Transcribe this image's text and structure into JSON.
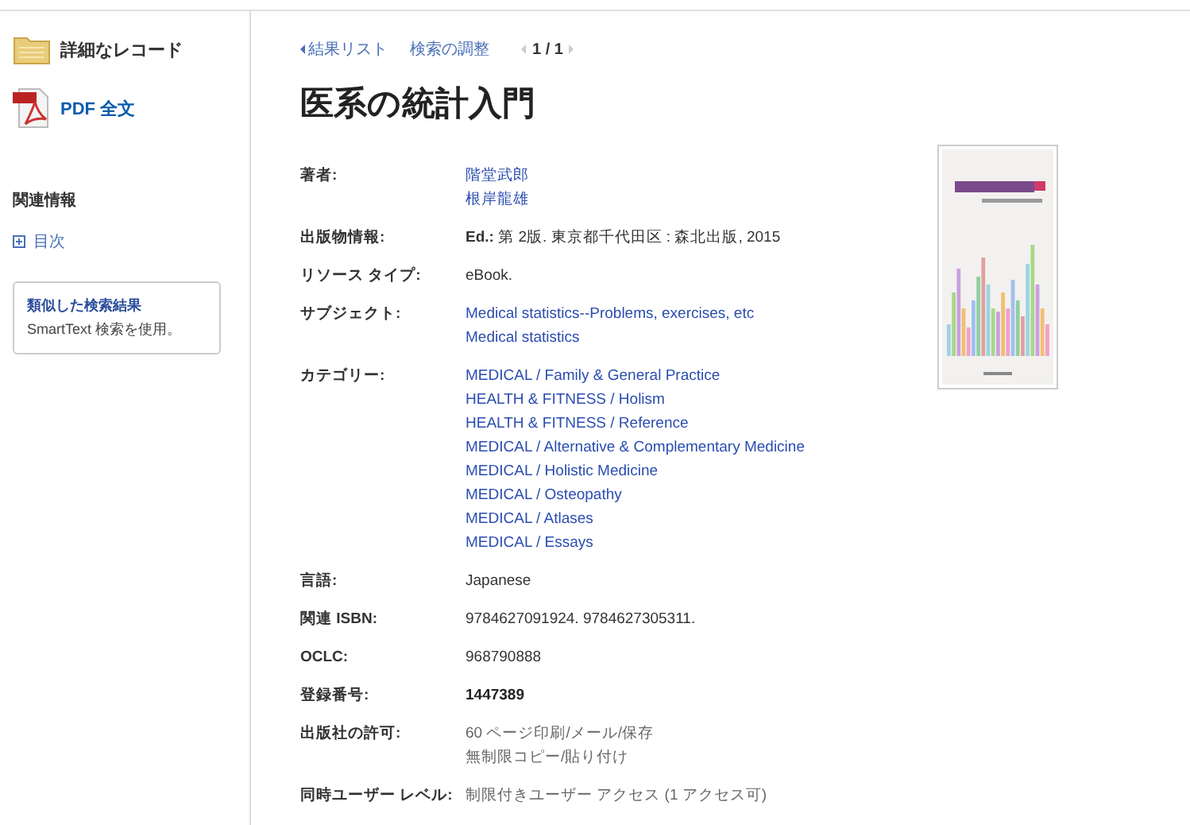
{
  "sidebar": {
    "items": [
      {
        "kind": "folder",
        "label": "詳細なレコード"
      },
      {
        "kind": "pdf",
        "label": "PDF 全文"
      }
    ],
    "related": {
      "heading": "関連情報",
      "links": [
        {
          "label": "目次"
        }
      ]
    },
    "similar": {
      "title": "類似した検索結果",
      "text": "SmartText 検索を使用。"
    }
  },
  "nav": {
    "back": "結果リスト",
    "refine": "検索の調整",
    "pager": "1 / 1"
  },
  "title": "医系の統計入門",
  "fields": [
    {
      "label": "著者:",
      "values": [
        {
          "kind": "link",
          "text": "階堂武郎"
        },
        {
          "kind": "link",
          "text": "根岸龍雄"
        }
      ]
    },
    {
      "label": "出版物情報:",
      "values": [
        {
          "kind": "rich",
          "text": "**Ed.:** 第 2版. 東京都千代田区 : 森北出版, 2015"
        }
      ]
    },
    {
      "label": "リソース タイプ:",
      "values": [
        {
          "kind": "text",
          "text": "eBook."
        }
      ]
    },
    {
      "label": "サブジェクト:",
      "values": [
        {
          "kind": "link",
          "text": "Medical statistics--Problems, exercises, etc"
        },
        {
          "kind": "link",
          "text": "Medical statistics"
        }
      ]
    },
    {
      "label": "カテゴリー:",
      "values": [
        {
          "kind": "link",
          "text": "MEDICAL / Family & General Practice"
        },
        {
          "kind": "link",
          "text": "HEALTH & FITNESS / Holism"
        },
        {
          "kind": "link",
          "text": "HEALTH & FITNESS / Reference"
        },
        {
          "kind": "link",
          "text": "MEDICAL / Alternative & Complementary Medicine"
        },
        {
          "kind": "link",
          "text": "MEDICAL / Holistic Medicine"
        },
        {
          "kind": "link",
          "text": "MEDICAL / Osteopathy"
        },
        {
          "kind": "link",
          "text": "MEDICAL / Atlases"
        },
        {
          "kind": "link",
          "text": "MEDICAL / Essays"
        }
      ]
    },
    {
      "label": "言語:",
      "values": [
        {
          "kind": "text",
          "text": "Japanese"
        }
      ]
    },
    {
      "label": "関連 ISBN:",
      "values": [
        {
          "kind": "text",
          "text": "9784627091924. 9784627305311."
        }
      ]
    },
    {
      "label": "OCLC:",
      "values": [
        {
          "kind": "text",
          "text": "968790888"
        }
      ]
    },
    {
      "label": "登録番号:",
      "values": [
        {
          "kind": "bold",
          "text": "1447389"
        }
      ]
    },
    {
      "label": "出版社の許可:",
      "values": [
        {
          "kind": "muted",
          "text": "60 ページ印刷/メール/保存"
        },
        {
          "kind": "muted",
          "text": "無制限コピー/貼り付け"
        }
      ]
    },
    {
      "label": "同時ユーザー レベル:",
      "values": [
        {
          "kind": "muted",
          "text": "制限付きユーザー アクセス (1 アクセス可)"
        }
      ]
    }
  ]
}
